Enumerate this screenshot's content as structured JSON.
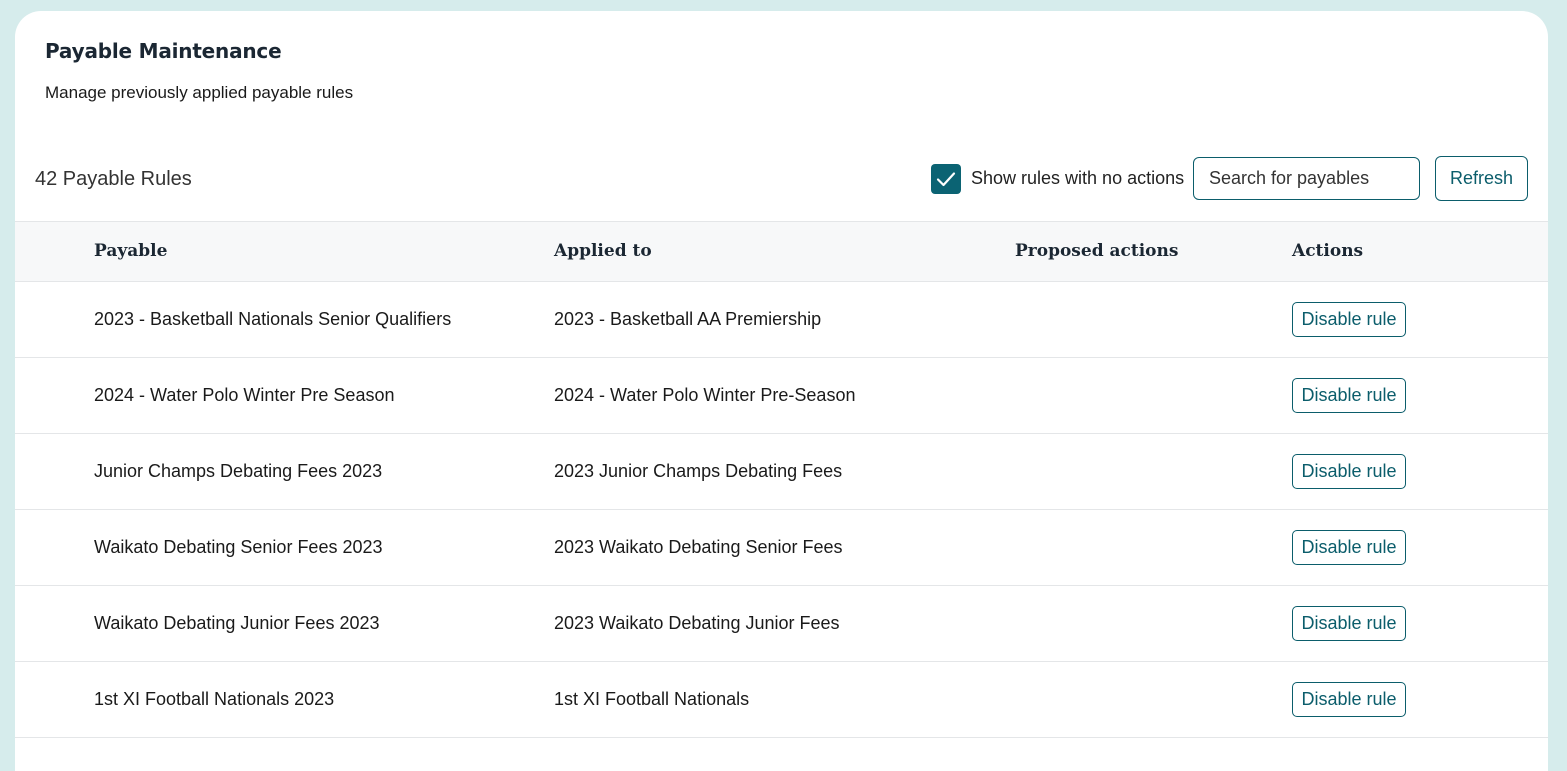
{
  "header": {
    "title": "Payable Maintenance",
    "subtitle": "Manage previously applied payable rules"
  },
  "toolbar": {
    "rule_count": "42 Payable Rules",
    "show_no_actions_label": "Show rules with no actions",
    "show_no_actions_checked": true,
    "search_placeholder": "Search for payables",
    "search_value": "",
    "refresh_label": "Refresh"
  },
  "table": {
    "columns": [
      "Payable",
      "Applied to",
      "Proposed actions",
      "Actions"
    ],
    "rows": [
      {
        "payable": "2023 - Basketball Nationals Senior Qualifiers",
        "applied_to": "2023 - Basketball AA Premiership",
        "proposed_actions": "",
        "action_label": "Disable rule"
      },
      {
        "payable": "2024 - Water Polo Winter Pre Season",
        "applied_to": "2024 - Water Polo Winter Pre-Season",
        "proposed_actions": "",
        "action_label": "Disable rule"
      },
      {
        "payable": "Junior Champs Debating Fees 2023",
        "applied_to": "2023 Junior Champs Debating Fees",
        "proposed_actions": "",
        "action_label": "Disable rule"
      },
      {
        "payable": "Waikato Debating Senior Fees 2023",
        "applied_to": "2023 Waikato Debating Senior Fees",
        "proposed_actions": "",
        "action_label": "Disable rule"
      },
      {
        "payable": "Waikato Debating Junior Fees 2023",
        "applied_to": "2023 Waikato Debating Junior Fees",
        "proposed_actions": "",
        "action_label": "Disable rule"
      },
      {
        "payable": "1st XI Football Nationals 2023",
        "applied_to": "1st XI Football Nationals",
        "proposed_actions": "",
        "action_label": "Disable rule"
      }
    ]
  },
  "colors": {
    "accent": "#0b6373",
    "page_background": "#d6ecec",
    "header_row_background": "#f7f8f9"
  },
  "icons": {
    "checkbox_check": "check-icon"
  }
}
